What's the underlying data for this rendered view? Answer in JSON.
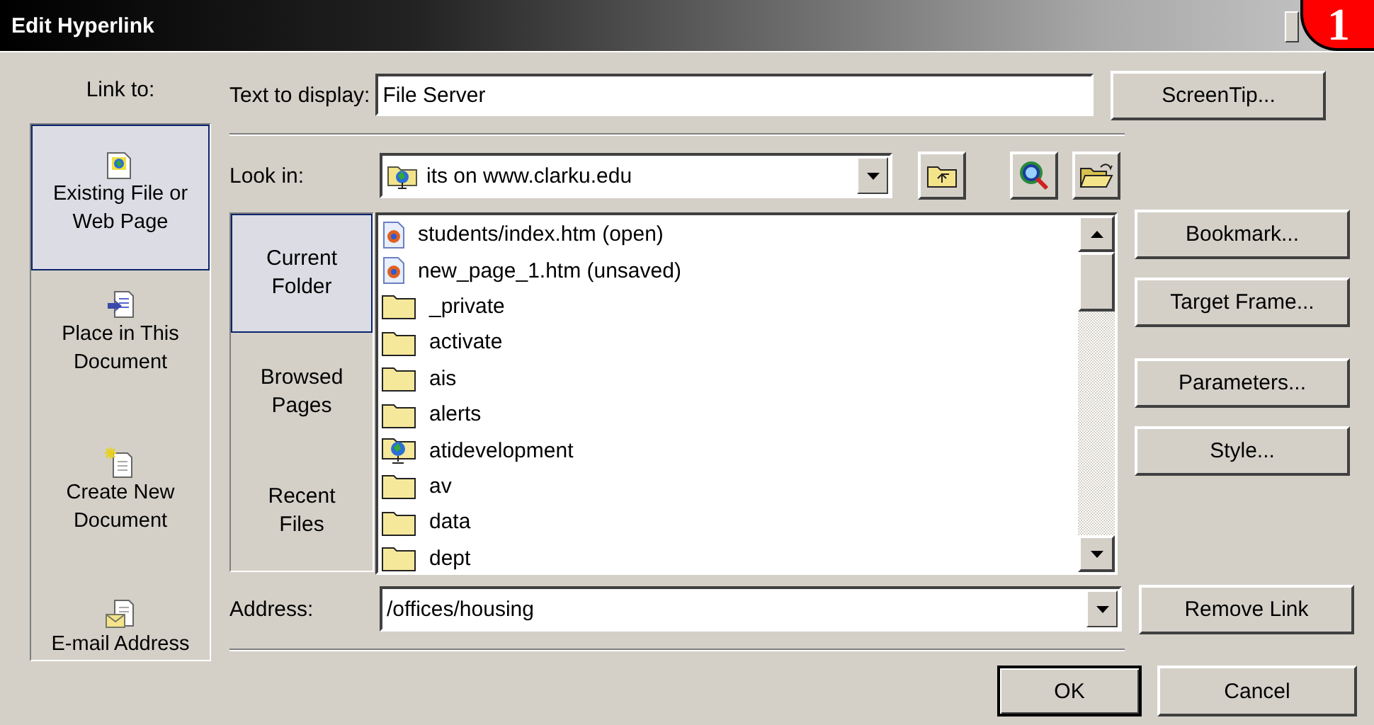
{
  "window": {
    "title": "Edit Hyperlink",
    "badge": "1"
  },
  "link_to": {
    "label": "Link to:",
    "items": [
      {
        "label": "Existing File or Web Page",
        "kind": "file",
        "selected": true
      },
      {
        "label": "Place in This Document",
        "kind": "place",
        "selected": false
      },
      {
        "label": "Create New Document",
        "kind": "new",
        "selected": false
      },
      {
        "label": "E-mail Address",
        "kind": "email",
        "selected": false
      }
    ]
  },
  "text_to_display": {
    "label": "Text to display:",
    "value": "File Server"
  },
  "screentip_button": "ScreenTip...",
  "look_in": {
    "label": "Look in:",
    "value": "its on www.clarku.edu"
  },
  "browse_tabs": [
    {
      "label": "Current Folder",
      "selected": true
    },
    {
      "label": "Browsed Pages",
      "selected": false
    },
    {
      "label": "Recent Files",
      "selected": false
    }
  ],
  "files": [
    {
      "name": "students/index.htm (open)",
      "kind": "page"
    },
    {
      "name": "new_page_1.htm (unsaved)",
      "kind": "page"
    },
    {
      "name": "_private",
      "kind": "folder"
    },
    {
      "name": "activate",
      "kind": "folder"
    },
    {
      "name": "ais",
      "kind": "folder"
    },
    {
      "name": "alerts",
      "kind": "folder"
    },
    {
      "name": "atidevelopment",
      "kind": "web_folder"
    },
    {
      "name": "av",
      "kind": "folder"
    },
    {
      "name": "data",
      "kind": "folder"
    },
    {
      "name": "dept",
      "kind": "folder"
    }
  ],
  "side_buttons": [
    "Bookmark...",
    "Target Frame...",
    "Parameters...",
    "Style..."
  ],
  "address": {
    "label": "Address:",
    "value": "/offices/housing"
  },
  "remove_link_button": "Remove Link",
  "buttons": [
    "OK",
    "Cancel"
  ]
}
